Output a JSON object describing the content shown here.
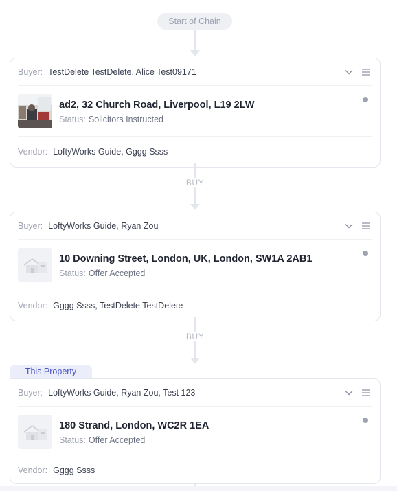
{
  "chain": {
    "start_label": "Start of Chain",
    "link_labels": [
      "BUY",
      "BUY"
    ]
  },
  "this_property_label": "This Property",
  "labels": {
    "buyer": "Buyer:",
    "vendor": "Vendor:",
    "status": "Status:"
  },
  "cards": [
    {
      "buyer": "TestDelete TestDelete, Alice Test09171",
      "address": "ad2, 32 Church Road, Liverpool, L19 2LW",
      "status": "Solicitors Instructed",
      "vendor": "LoftyWorks Guide, Gggg Ssss",
      "thumbnail": "photo"
    },
    {
      "buyer": "LoftyWorks Guide, Ryan Zou",
      "address": "10 Downing Street, London, UK, London, SW1A 2AB1",
      "status": "Offer Accepted",
      "vendor": "Gggg Ssss, TestDelete TestDelete",
      "thumbnail": "house-placeholder-icon"
    },
    {
      "buyer": "LoftyWorks Guide, Ryan Zou, Test 123",
      "address": "180 Strand, London, WC2R 1EA",
      "status": "Offer Accepted",
      "vendor": "Gggg Ssss",
      "thumbnail": "house-placeholder-icon"
    }
  ],
  "icons": {
    "expand": "chevron-down-icon",
    "menu": "menu-icon",
    "status_dot": "status-dot"
  },
  "colors": {
    "accent": "#4a55c4",
    "accent_bg": "#ebedfb",
    "muted": "#9ea3b0",
    "border": "#e3e6ec"
  }
}
